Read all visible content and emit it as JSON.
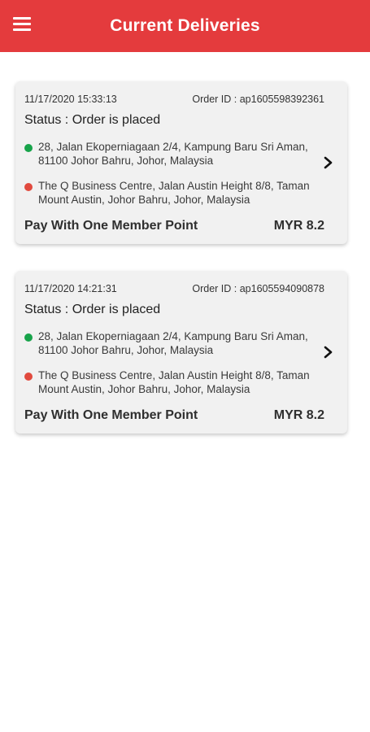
{
  "header": {
    "title": "Current Deliveries",
    "menu_icon": "hamburger-menu-icon",
    "color": "#e43b3d"
  },
  "deliveries": [
    {
      "timestamp": "11/17/2020 15:33:13",
      "order_id": "Order ID : ap1605598392361",
      "status": "Status : Order is placed",
      "pickup": "28, Jalan Ekoperniagaan 2/4, Kampung Baru Sri Aman, 81100 Johor Bahru, Johor, Malaysia",
      "dropoff": "The Q Business Centre, Jalan Austin Height 8/8, Taman Mount Austin, Johor Bahru, Johor, Malaysia",
      "payment": "Pay With One Member Point",
      "amount": "MYR 8.2"
    },
    {
      "timestamp": "11/17/2020 14:21:31",
      "order_id": "Order ID : ap1605594090878",
      "status": "Status : Order is placed",
      "pickup": "28, Jalan Ekoperniagaan 2/4, Kampung Baru Sri Aman, 81100 Johor Bahru, Johor, Malaysia",
      "dropoff": "The Q Business Centre, Jalan Austin Height 8/8, Taman Mount Austin, Johor Bahru, Johor, Malaysia",
      "payment": "Pay With One Member Point",
      "amount": "MYR 8.2"
    }
  ],
  "icons": {
    "pickup_dot": "#17a34a",
    "dropoff_dot": "#e14a3e",
    "chevron": "chevron-right-icon"
  }
}
